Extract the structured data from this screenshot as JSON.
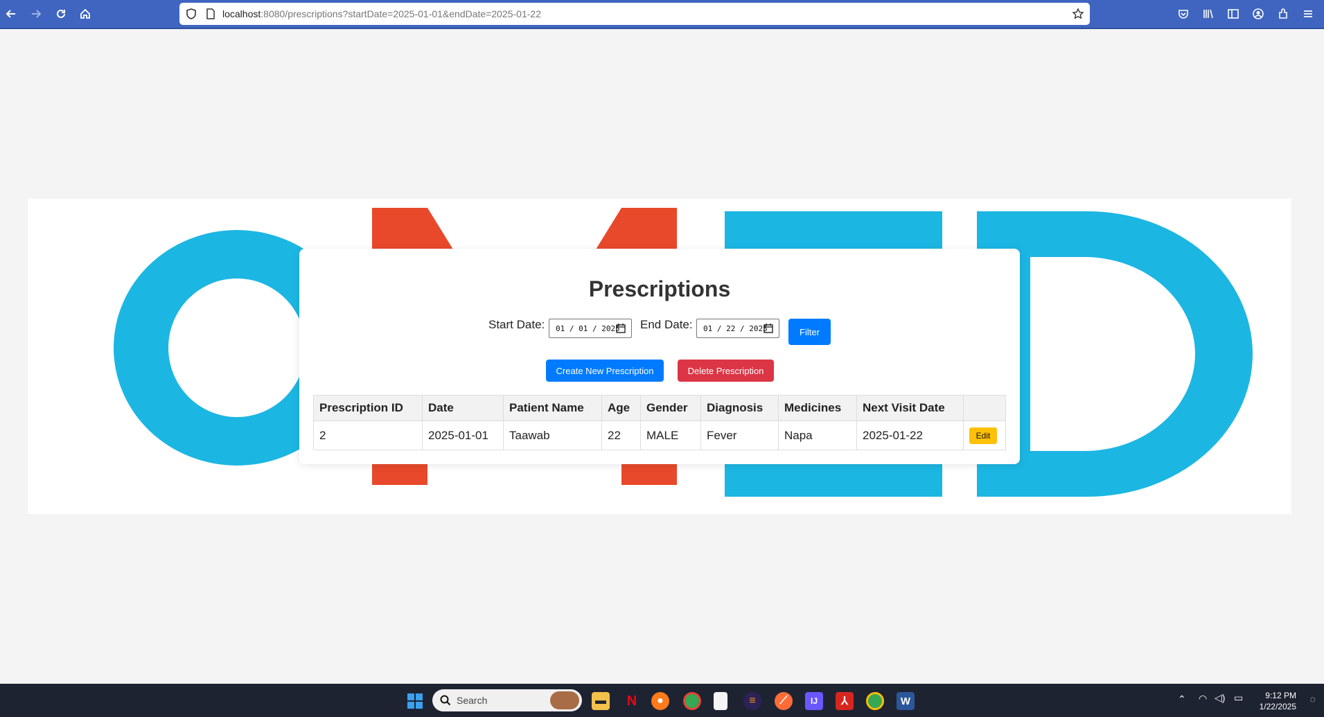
{
  "browser": {
    "url_host": "localhost",
    "url_rest": ":8080/prescriptions?startDate=2025-01-01&endDate=2025-01-22",
    "icons": [
      "back-icon",
      "forward-icon",
      "reload-icon",
      "home-icon",
      "shield-icon",
      "page-icon",
      "bookmark-star-icon",
      "pocket-icon",
      "library-icon",
      "sidebar-icon",
      "account-icon",
      "extensions-icon",
      "menu-icon"
    ]
  },
  "page": {
    "title": "Prescriptions",
    "filter": {
      "start_label": "Start Date:",
      "start_value": "01 / 01 / 2025",
      "end_label": "End Date:",
      "end_value": "01 / 22 / 2025",
      "filter_button": "Filter"
    },
    "actions": {
      "create_label": "Create New Prescription",
      "delete_label": "Delete Prescription"
    },
    "table": {
      "headers": [
        "Prescription ID",
        "Date",
        "Patient Name",
        "Age",
        "Gender",
        "Diagnosis",
        "Medicines",
        "Next Visit Date",
        ""
      ],
      "rows": [
        {
          "id": "2",
          "date": "2025-01-01",
          "patient": "Taawab",
          "age": "22",
          "gender": "MALE",
          "diagnosis": "Fever",
          "medicines": "Napa",
          "next_visit": "2025-01-22",
          "edit_label": "Edit"
        }
      ]
    },
    "banner": {
      "logo_letters": "OMD",
      "colors": {
        "cyan": "#1cb6e3",
        "orange": "#e8492a"
      }
    }
  },
  "taskbar": {
    "search_label": "Search",
    "time": "9:12 PM",
    "date": "1/22/2025",
    "pinned": [
      "windows-start-icon",
      "file-explorer-icon",
      "netflix-icon",
      "firefox-icon",
      "chrome-icon",
      "notepad-icon",
      "eclipse-icon",
      "postman-icon",
      "intellij-icon",
      "acrobat-icon",
      "chrome-profile-icon",
      "word-icon"
    ]
  },
  "colors": {
    "toolbar": "#3f65c0",
    "primary": "#007bff",
    "danger": "#dc3545",
    "warning": "#ffc107"
  }
}
